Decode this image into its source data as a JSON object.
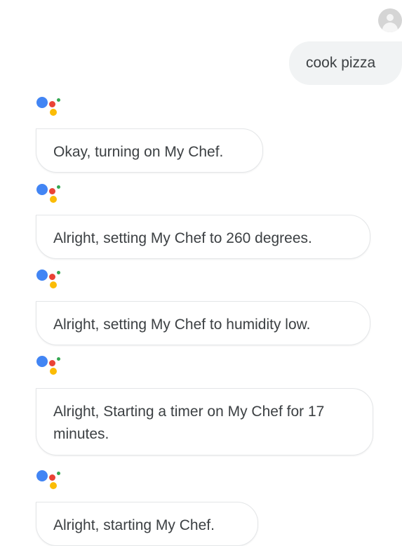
{
  "icons": {
    "user_avatar": "user-avatar-icon",
    "assistant_logo": "google-assistant-logo-icon"
  },
  "colors": {
    "assistant_blue": "#4285F4",
    "assistant_red": "#EA4335",
    "assistant_yellow": "#FBBC05",
    "assistant_green": "#34A853",
    "user_bubble_bg": "#f1f3f4"
  },
  "conversation": {
    "user_message": "cook pizza",
    "assistant_messages": [
      "Okay, turning on My Chef.",
      "Alright, setting My Chef to 260 degrees.",
      "Alright, setting My Chef to humidity low.",
      "Alright, Starting a timer on My Chef for 17 minutes.",
      "Alright, starting My Chef."
    ]
  }
}
